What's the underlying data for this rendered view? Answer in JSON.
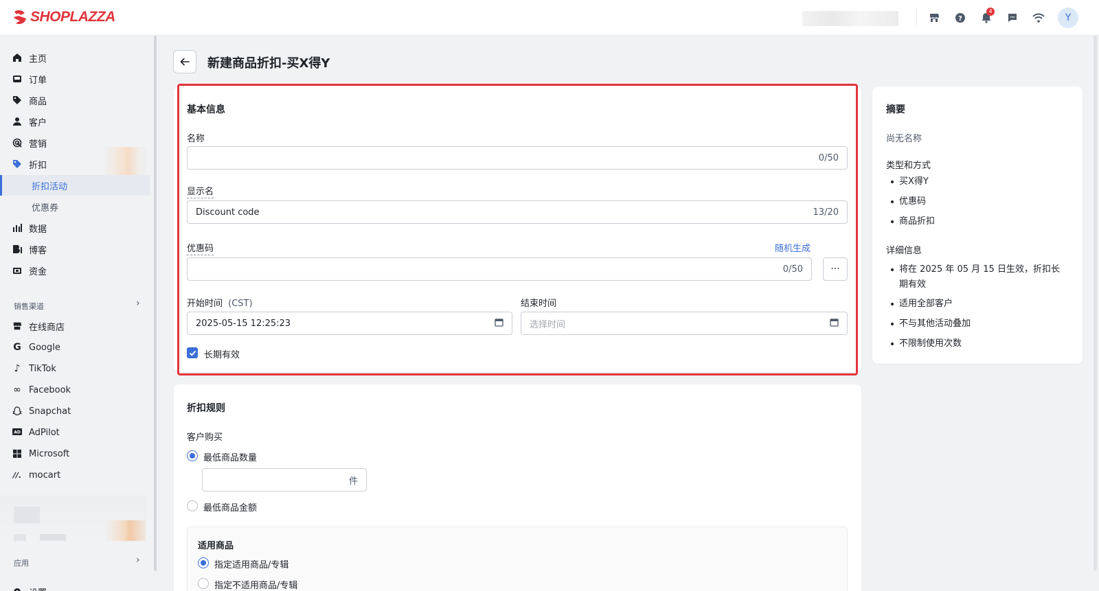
{
  "brand": {
    "name": "SHOPLAZZA",
    "color": "#e1343b",
    "accent": "#3b6fd8",
    "highlight": "#e2343b"
  },
  "topbar": {
    "icons": [
      "store-icon",
      "help-icon",
      "bell-icon",
      "chat-icon",
      "wifi-icon"
    ],
    "notification_count": "4",
    "avatar_initial": "Y"
  },
  "sidebar": {
    "items": [
      {
        "label": "主页",
        "icon": "home-icon"
      },
      {
        "label": "订单",
        "icon": "inbox-icon"
      },
      {
        "label": "商品",
        "icon": "tag-icon"
      },
      {
        "label": "客户",
        "icon": "person-icon"
      },
      {
        "label": "营销",
        "icon": "target-icon"
      },
      {
        "label": "折扣",
        "icon": "discount-icon"
      },
      {
        "label": "折扣活动"
      },
      {
        "label": "优惠券"
      },
      {
        "label": "数据",
        "icon": "bar-chart-icon"
      },
      {
        "label": "博客",
        "icon": "blog-icon"
      },
      {
        "label": "资金",
        "icon": "wallet-icon"
      }
    ],
    "channels_title": "销售渠道",
    "channels": [
      {
        "label": "在线商店",
        "icon": "store-icon"
      },
      {
        "label": "Google",
        "icon": "google-icon"
      },
      {
        "label": "TikTok",
        "icon": "tiktok-icon"
      },
      {
        "label": "Facebook",
        "icon": "meta-icon"
      },
      {
        "label": "Snapchat",
        "icon": "snapchat-icon"
      },
      {
        "label": "AdPilot",
        "icon": "adpilot-icon"
      },
      {
        "label": "Microsoft",
        "icon": "microsoft-icon"
      },
      {
        "label": "mocart",
        "icon": "mocart-icon"
      }
    ],
    "apps_title": "应用",
    "settings_label": "设置"
  },
  "header": {
    "title": "新建商品折扣-买X得Y"
  },
  "basic_info": {
    "title": "基本信息",
    "name_label": "名称",
    "name_value": "",
    "name_count": "0/50",
    "display_label": "显示名",
    "display_value": "Discount code",
    "display_count": "13/20",
    "code_label": "优惠码",
    "random_link": "随机生成",
    "code_value": "",
    "code_count": "0/50",
    "more_label": "···",
    "start_label": "开始时间",
    "start_tz": "(CST)",
    "start_value": "2025-05-15 12:25:23",
    "end_label": "结束时间",
    "end_placeholder": "选择时间",
    "longterm_label": "长期有效",
    "longterm_checked": true
  },
  "rules": {
    "title": "折扣规则",
    "customer_buy_label": "客户购买",
    "min_qty_label": "最低商品数量",
    "qty_unit": "件",
    "min_amount_label": "最低商品金额",
    "applicable_title": "适用商品",
    "opt_include": "指定适用商品/专辑",
    "opt_exclude": "指定不适用商品/专辑"
  },
  "summary": {
    "title": "摘要",
    "no_name": "尚无名称",
    "type_title": "类型和方式",
    "type_items": [
      "买X得Y",
      "优惠码",
      "商品折扣"
    ],
    "detail_title": "详细信息",
    "detail_items": [
      "将在 2025 年 05 月 15 日生效，折扣长期有效",
      "适用全部客户",
      "不与其他活动叠加",
      "不限制使用次数"
    ]
  }
}
